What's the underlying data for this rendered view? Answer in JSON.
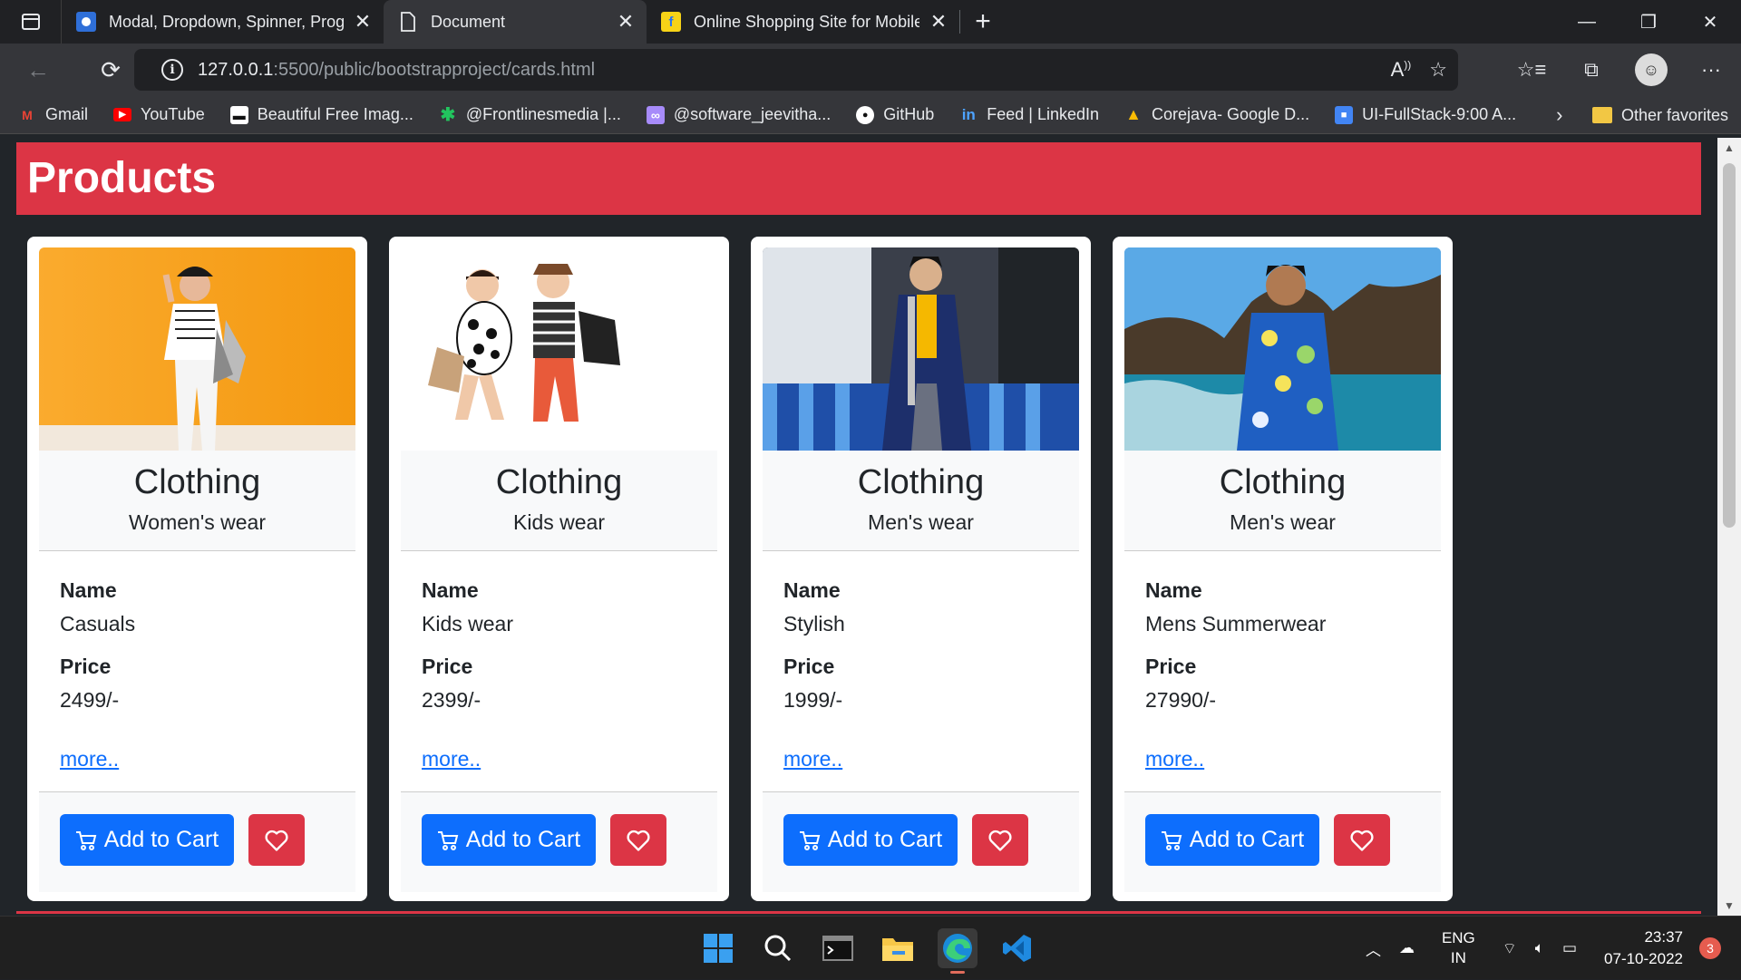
{
  "browser": {
    "tabs": [
      {
        "title": "Modal, Dropdown, Spinner, Prog",
        "favicon_color": "#2f6fd8",
        "active": false
      },
      {
        "title": "Document",
        "favicon_color": "none",
        "active": true
      },
      {
        "title": "Online Shopping Site for Mobile",
        "favicon_color": "#f7d317",
        "active": false
      }
    ],
    "url_host": "127.0.0.1",
    "url_path": ":5500/public/bootstrapproject/cards.html",
    "favorites": [
      {
        "label": "Gmail",
        "icon": "gmail-icon",
        "color": "#ea4335",
        "glyph": "M"
      },
      {
        "label": "YouTube",
        "icon": "youtube-icon",
        "color": "#ff0000",
        "glyph": "▶"
      },
      {
        "label": "Beautiful Free Imag...",
        "icon": "unsplash-icon",
        "color": "#111111",
        "glyph": "▪"
      },
      {
        "label": "@Frontlinesmedia |...",
        "icon": "asterisk-icon",
        "color": "#22c55e",
        "glyph": "✱"
      },
      {
        "label": "@software_jeevitha...",
        "icon": "link-icon",
        "color": "#a78bfa",
        "glyph": "∞"
      },
      {
        "label": "GitHub",
        "icon": "github-icon",
        "color": "#ffffff",
        "glyph": "●"
      },
      {
        "label": "Feed | LinkedIn",
        "icon": "linkedin-icon",
        "color": "#0a66c2",
        "glyph": "in"
      },
      {
        "label": "Corejava- Google D...",
        "icon": "google-drive-icon",
        "color": "#34a853",
        "glyph": "▲"
      },
      {
        "label": "UI-FullStack-9:00 A...",
        "icon": "classroom-icon",
        "color": "#4285f4",
        "glyph": "■"
      }
    ],
    "other_favorites": "Other favorites"
  },
  "page": {
    "heading": "Products",
    "more_label": "more..",
    "name_label": "Name",
    "price_label": "Price",
    "cart_label": "Add to Cart",
    "cards": [
      {
        "category": "Clothing",
        "subtitle": "Women's wear",
        "name": "Casuals",
        "price": "2499/-",
        "image": "woman-shopping"
      },
      {
        "category": "Clothing",
        "subtitle": "Kids wear",
        "name": "Kids wear",
        "price": "2399/-",
        "image": "kids"
      },
      {
        "category": "Clothing",
        "subtitle": "Men's wear",
        "name": "Stylish",
        "price": "1999/-",
        "image": "man-coat"
      },
      {
        "category": "Clothing",
        "subtitle": "Men's wear",
        "name": "Mens Summerwear",
        "price": "27990/-",
        "image": "man-beach"
      }
    ]
  },
  "taskbar": {
    "lang_top": "ENG",
    "lang_bottom": "IN",
    "time": "23:37",
    "date": "07-10-2022",
    "notifications": "3"
  },
  "colors": {
    "primary": "#0d6efd",
    "danger": "#dc3545",
    "page_bg": "#212529"
  }
}
